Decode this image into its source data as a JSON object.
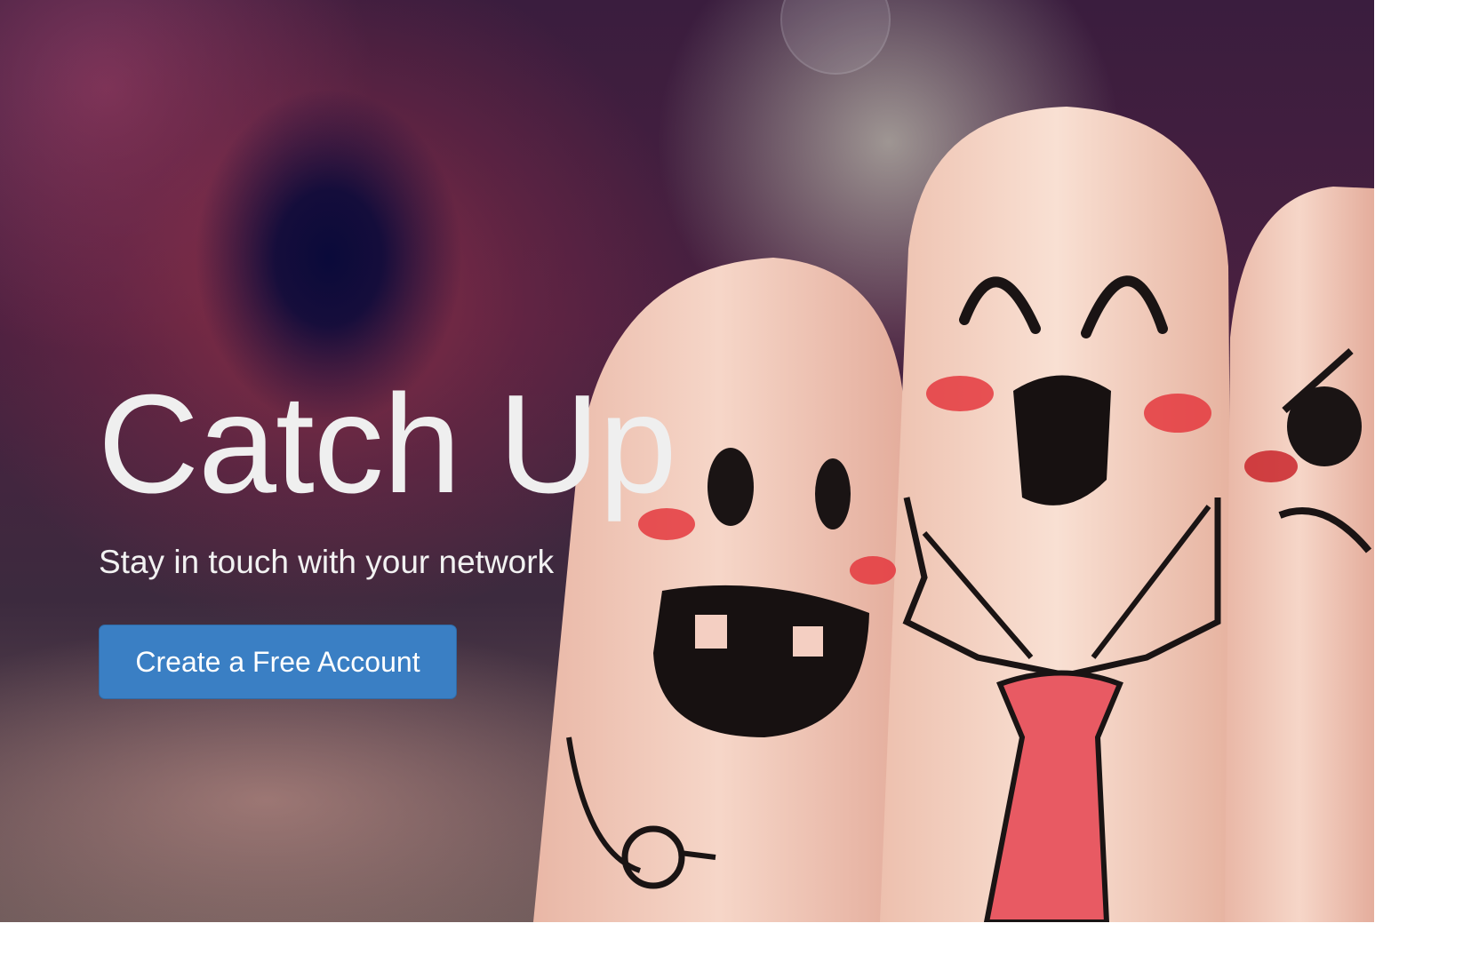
{
  "hero": {
    "title": "Catch Up",
    "tagline": "Stay in touch with your network",
    "cta_label": "Create a Free Account"
  },
  "colors": {
    "cta_background": "#3a7fc4",
    "title_text": "#efefef"
  }
}
